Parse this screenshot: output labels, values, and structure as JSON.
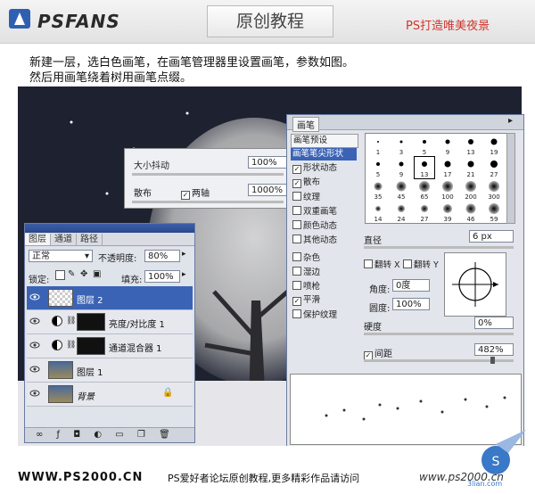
{
  "header": {
    "logo": "PSFANS",
    "title": "原创教程",
    "slogan": "PS打造唯美夜景"
  },
  "intro": {
    "line1": "新建一层，选白色画笔，在画笔管理器里设置画笔，参数如图。",
    "line2": "然后用画笔绕着树用画笔点缀。"
  },
  "jitter_panel": {
    "size_jitter_label": "大小抖动",
    "size_jitter_value": "100%",
    "scatter_label": "散布",
    "both_axes_label": "两轴",
    "both_axes_checked": true,
    "scatter_value": "1000%"
  },
  "layers_panel": {
    "tabs": [
      "图层",
      "通道",
      "路径"
    ],
    "blend_mode": "正常",
    "opacity_label": "不透明度:",
    "opacity_value": "80%",
    "lock_label": "锁定:",
    "fill_label": "填充:",
    "fill_value": "100%",
    "layers": [
      {
        "name": "图层 2",
        "selected": true
      },
      {
        "name": "亮度/对比度 1",
        "selected": false
      },
      {
        "name": "通道混合器 1",
        "selected": false
      },
      {
        "name": "图层 1",
        "selected": false
      },
      {
        "name": "背景",
        "selected": false
      }
    ]
  },
  "brush_panel": {
    "tab": "画笔",
    "presets_label": "画笔预设",
    "tip_shape_label": "画笔笔尖形状",
    "options": [
      {
        "label": "形状动态",
        "checked": true
      },
      {
        "label": "散布",
        "checked": true
      },
      {
        "label": "纹理",
        "checked": false
      },
      {
        "label": "双重画笔",
        "checked": false
      },
      {
        "label": "颜色动态",
        "checked": false
      },
      {
        "label": "其他动态",
        "checked": false
      },
      {
        "label": "杂色",
        "checked": false
      },
      {
        "label": "湿边",
        "checked": false
      },
      {
        "label": "喷枪",
        "checked": false
      },
      {
        "label": "平滑",
        "checked": true
      },
      {
        "label": "保护纹理",
        "checked": false
      }
    ],
    "tip_sizes": [
      "1",
      "3",
      "5",
      "9",
      "13",
      "19",
      "5",
      "9",
      "13",
      "17",
      "21",
      "27",
      "35",
      "45",
      "65",
      "100",
      "200",
      "300",
      "14",
      "24",
      "27",
      "39",
      "46",
      "59"
    ],
    "diameter_label": "直径",
    "diameter_value": "6 px",
    "flip_x_label": "翻转 X",
    "flip_y_label": "翻转 Y",
    "angle_label": "角度:",
    "angle_value": "0度",
    "roundness_label": "圆度:",
    "roundness_value": "100%",
    "hardness_label": "硬度",
    "hardness_value": "0%",
    "spacing_label": "间距",
    "spacing_checked": true,
    "spacing_value": "482%"
  },
  "footer": {
    "url": "WWW.PS2000.CN",
    "note": "PS爱好者论坛原创教程,更多精彩作品请访问",
    "url2": "www.ps2000.cn",
    "watermark": "3lian.com"
  }
}
